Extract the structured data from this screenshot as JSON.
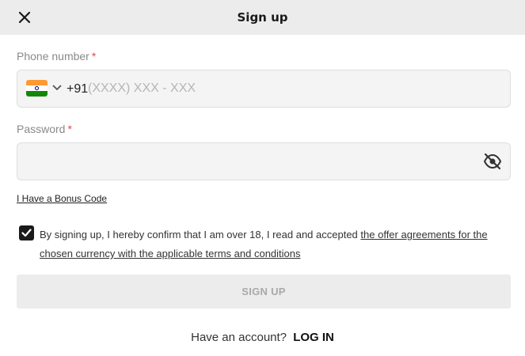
{
  "header": {
    "title": "Sign up",
    "close_icon": "close-icon"
  },
  "phone": {
    "label": "Phone number",
    "required_mark": "*",
    "country_flag": "india-flag-icon",
    "dial_code": "+91",
    "placeholder": "(XXXX) XXX - XXX",
    "value": ""
  },
  "password": {
    "label": "Password",
    "required_mark": "*",
    "value": "",
    "visibility_icon": "eye-off-icon"
  },
  "bonus_link": "I Have a Bonus Code",
  "consent": {
    "checked": true,
    "text": "By signing up, I hereby confirm that I am over 18, I read and accepted ",
    "link": "the offer agreements for the chosen currency with the applicable terms and conditions"
  },
  "signup_button": "SIGN UP",
  "footer": {
    "prompt": "Have an account?",
    "login_label": "LOG IN"
  },
  "colors": {
    "header_bg": "#ececec",
    "required": "#e04a4a",
    "input_bg": "#f4f4f4",
    "button_bg": "#ececec",
    "button_text": "#a9a9a9"
  }
}
